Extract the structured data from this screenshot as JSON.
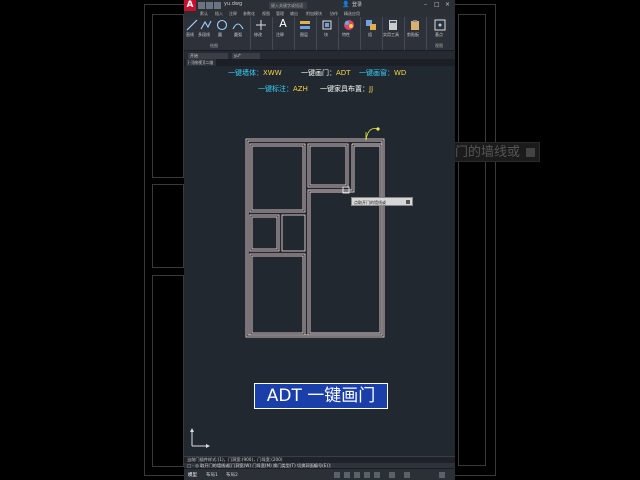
{
  "titlebar": {
    "logo": "A",
    "doc_title": "yu.dwg",
    "search_placeholder": "键入关键字或短语",
    "login": "登录"
  },
  "menubar": {
    "items": [
      "默认",
      "插入",
      "注释",
      "参数化",
      "视图",
      "管理",
      "输出",
      "附加模块",
      "协作",
      "精选应用"
    ]
  },
  "ribbon": {
    "groups": [
      {
        "label": "绘图",
        "tools": [
          "直线",
          "多段线",
          "圆",
          "圆弧"
        ]
      },
      {
        "label": "修改",
        "tools": [
          "修改"
        ]
      },
      {
        "label": "注释",
        "tools": [
          "注释"
        ]
      },
      {
        "label": "图层",
        "tools": [
          "图层"
        ]
      },
      {
        "label": "块",
        "tools": [
          "块"
        ]
      },
      {
        "label": "特性",
        "tools": [
          "特性"
        ]
      },
      {
        "label": "组",
        "tools": [
          "组"
        ]
      },
      {
        "label": "实用工具",
        "tools": [
          "实用工具"
        ]
      },
      {
        "label": "剪贴板",
        "tools": [
          "剪贴板"
        ]
      },
      {
        "label": "视图",
        "tools": [
          "基点"
        ]
      }
    ]
  },
  "propbar": {
    "field1": "开始",
    "field2": "yu*"
  },
  "doc_tab": "[-][俯视][二维线框]",
  "commands": {
    "wall": {
      "key": "一键墙体：",
      "value": "XWW"
    },
    "door": {
      "key": "一键画门：",
      "value": "ADT"
    },
    "window": {
      "key": "一键画窗：",
      "value": "WD"
    },
    "dim": {
      "key": "一键标注：",
      "value": "AZH"
    },
    "furniture": {
      "key": "一键家具布置：",
      "value": "JJ"
    }
  },
  "tooltip": "点取开门的墙线或",
  "ghost_tooltip": "门的墙线或",
  "banner": "ADT  一键画门",
  "cmdline": {
    "history": "当前门插件样式:(1)，门洞宽:(900)，门垛宽:(200)",
    "current": "□ - ◎ 取开门的墙线或[门洞宽(W) 门垛宽(M) 换门类型(T) 切换洞面编号(E)]:"
  },
  "statusbar": {
    "tabs": [
      "模型",
      "布局1",
      "布局2"
    ]
  },
  "colors": {
    "canvas": "#212830",
    "wall": "#e7d2d2",
    "banner": "#1a3fa8",
    "key_text": "#ffffff",
    "value_text": "#f5d547",
    "cmd_text_cyan": "#39d3ff",
    "grip": "#e8f04a"
  }
}
